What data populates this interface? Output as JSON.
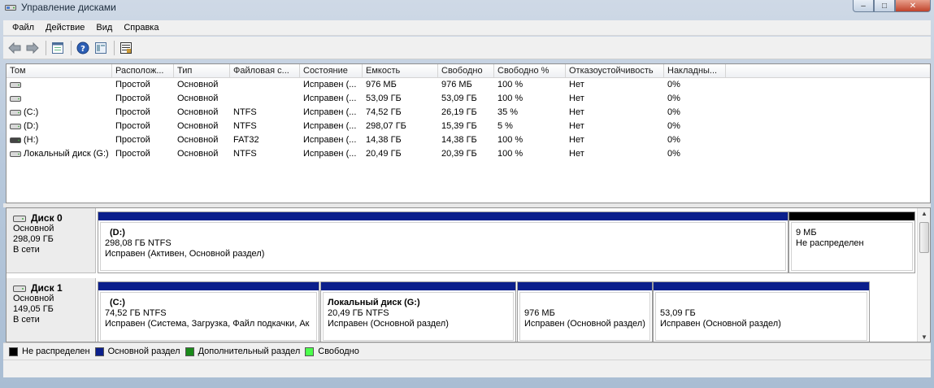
{
  "window": {
    "title": "Управление дисками",
    "buttons": {
      "minimize": "‒",
      "maximize": "□",
      "close": "✕"
    }
  },
  "menu": [
    "Файл",
    "Действие",
    "Вид",
    "Справка"
  ],
  "toolbar": [
    "back-icon",
    "forward-icon",
    "properties-icon",
    "help-icon",
    "console-icon",
    "export-icon"
  ],
  "table": {
    "columns": [
      "Том",
      "Располож...",
      "Тип",
      "Файловая с...",
      "Состояние",
      "Емкость",
      "Свободно",
      "Свободно %",
      "Отказоустойчивость",
      "Накладны..."
    ],
    "rows": [
      {
        "icon": "volume-icon",
        "values": [
          "",
          "Простой",
          "Основной",
          "",
          "Исправен (...",
          "976 МБ",
          "976 МБ",
          "100 %",
          "Нет",
          "0%"
        ]
      },
      {
        "icon": "volume-icon",
        "values": [
          "",
          "Простой",
          "Основной",
          "",
          "Исправен (...",
          "53,09 ГБ",
          "53,09 ГБ",
          "100 %",
          "Нет",
          "0%"
        ]
      },
      {
        "icon": "volume-icon",
        "values": [
          "(C:)",
          "Простой",
          "Основной",
          "NTFS",
          "Исправен (...",
          "74,52 ГБ",
          "26,19 ГБ",
          "35 %",
          "Нет",
          "0%"
        ]
      },
      {
        "icon": "volume-icon",
        "values": [
          "(D:)",
          "Простой",
          "Основной",
          "NTFS",
          "Исправен (...",
          "298,07 ГБ",
          "15,39 ГБ",
          "5 %",
          "Нет",
          "0%"
        ]
      },
      {
        "icon": "removable-icon",
        "values": [
          "(H:)",
          "Простой",
          "Основной",
          "FAT32",
          "Исправен (...",
          "14,38 ГБ",
          "14,38 ГБ",
          "100 %",
          "Нет",
          "0%"
        ]
      },
      {
        "icon": "volume-icon",
        "values": [
          "Локальный диск (G:)",
          "Простой",
          "Основной",
          "NTFS",
          "Исправен (...",
          "20,49 ГБ",
          "20,39 ГБ",
          "100 %",
          "Нет",
          "0%"
        ]
      }
    ]
  },
  "disks": [
    {
      "name": "Диск 0",
      "type": "Основной",
      "size": "298,09 ГБ",
      "status": "В сети",
      "partitions": [
        {
          "kind": "primary",
          "name": "(D:)",
          "size": "298,08 ГБ NTFS",
          "status": "Исправен (Активен, Основной раздел)"
        },
        {
          "kind": "unallocated",
          "name": "",
          "size": "9 МБ",
          "status": "Не распределен"
        }
      ]
    },
    {
      "name": "Диск 1",
      "type": "Основной",
      "size": "149,05 ГБ",
      "status": "В сети",
      "partitions": [
        {
          "kind": "primary",
          "name": "(C:)",
          "size": "74,52 ГБ NTFS",
          "status": "Исправен (Система, Загрузка, Файл подкачки, Ак"
        },
        {
          "kind": "primary",
          "name": "Локальный диск  (G:)",
          "size": "20,49 ГБ NTFS",
          "status": "Исправен (Основной раздел)"
        },
        {
          "kind": "primary",
          "name": "",
          "size": "976 МБ",
          "status": "Исправен (Основной раздел)"
        },
        {
          "kind": "primary",
          "name": "",
          "size": "53,09 ГБ",
          "status": "Исправен (Основной раздел)"
        }
      ]
    }
  ],
  "legend": [
    {
      "label": "Не распределен",
      "color": "#000000"
    },
    {
      "label": "Основной раздел",
      "color": "#0b1f8c"
    },
    {
      "label": "Дополнительный раздел",
      "color": "#1a8a1a"
    },
    {
      "label": "Свободно",
      "color": "#4cff4c"
    }
  ]
}
